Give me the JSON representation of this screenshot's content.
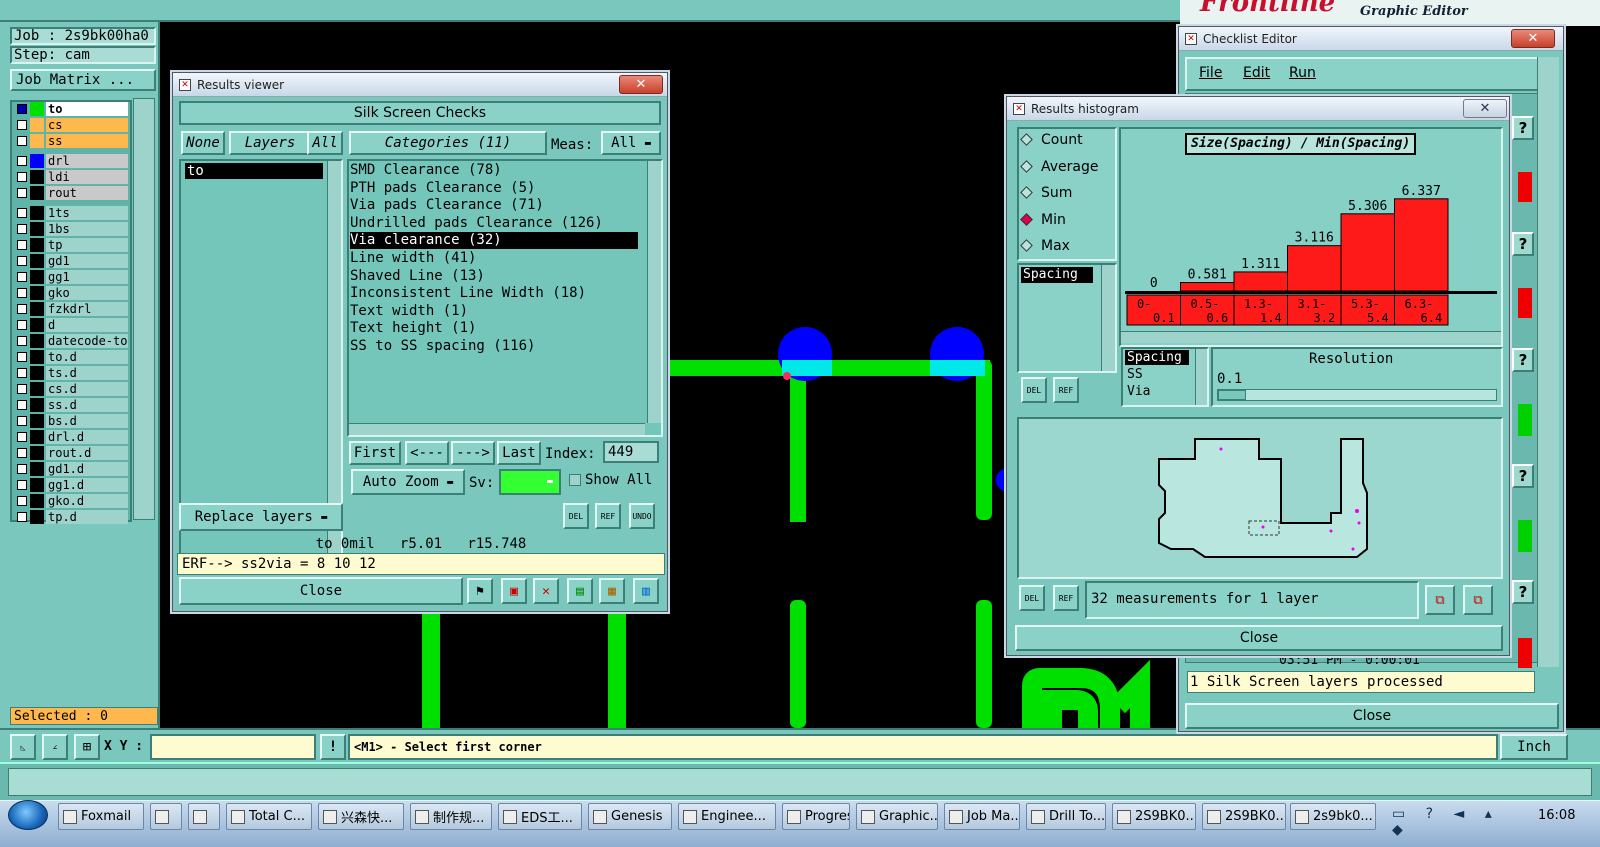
{
  "app": {
    "logo_text": "Frontline",
    "graphic_editor": "Graphic Editor"
  },
  "left_panel": {
    "job_label": "Job : 2s9bk00ha0",
    "step_label": "Step: cam",
    "job_matrix_button": "Job Matrix ...",
    "layers": [
      "to",
      "cs",
      "ss",
      "drl",
      "ldi",
      "rout",
      "1ts",
      "1bs",
      "tp",
      "gd1",
      "gg1",
      "gko",
      "fzkdrl",
      "d",
      "datecode-to",
      "to.d",
      "ts.d",
      "cs.d",
      "ss.d",
      "bs.d",
      "drl.d",
      "rout.d",
      "gd1.d",
      "gg1.d",
      "gko.d",
      "tp.d"
    ],
    "selected_label": "Selected : 0"
  },
  "results_viewer": {
    "title": "Results viewer",
    "header": "Silk Screen Checks",
    "none_btn": "None",
    "layers_btn": "Layers",
    "all_btn": "All",
    "layer_item": "to",
    "categories_btn": "Categories (11)",
    "meas_label": "Meas:",
    "meas_value": "All",
    "categories": [
      "SMD Clearance (78)",
      "PTH pads Clearance (5)",
      "Via pads Clearance (71)",
      "Undrilled pads Clearance (126)",
      "Via clearance (32)",
      "Line width (41)",
      "Shaved Line (13)",
      "Inconsistent Line Width (18)",
      "Text width (1)",
      "Text height (1)",
      "SS to SS spacing (116)"
    ],
    "selected_category": "Via clearance (32)",
    "first_btn": "First",
    "prev_btn": "<---",
    "next_btn": "--->",
    "last_btn": "Last",
    "index_label": "Index:",
    "index_value": "449",
    "auto_zoom": "Auto Zoom",
    "sv_label": "Sv:",
    "show_all": "Show All",
    "replace_layers": "Replace layers",
    "status_line": "to 0mil   r5.01   r15.748",
    "erf_line": "ERF--> ss2via = 8 10 12",
    "close_btn": "Close",
    "del_label": "DEL",
    "ref_label": "REF",
    "undo_label": "UNDO"
  },
  "histogram": {
    "title": "Results histogram",
    "radios": [
      "Count",
      "Average",
      "Sum",
      "Min",
      "Max"
    ],
    "selected_radio": "Min",
    "chart_title": "Size(Spacing) / Min(Spacing)",
    "list_items": [
      "Spacing"
    ],
    "list2": [
      "Spacing",
      "SS",
      "Via"
    ],
    "resolution_label": "Resolution",
    "resolution_value": "0.1",
    "measurements": "32 measurements for 1 layer",
    "close_btn": "Close",
    "del_label": "DEL",
    "ref_label": "REF"
  },
  "chart_data": {
    "type": "bar",
    "title": "Size(Spacing) / Min(Spacing)",
    "categories": [
      "0-\n0.1",
      "0.5-\n0.6",
      "1.3-\n1.4",
      "3.1-\n3.2",
      "5.3-\n5.4",
      "6.3-\n6.4"
    ],
    "values": [
      0,
      0.581,
      1.311,
      3.116,
      5.306,
      6.337
    ],
    "value_labels": [
      "0",
      "0.581",
      "1.311",
      "3.116",
      "5.306",
      "6.337"
    ],
    "ylim": [
      0,
      6.6
    ],
    "bar_color": "#ff1a1a"
  },
  "checklist": {
    "title": "Checklist Editor",
    "menu": [
      "File",
      "Edit",
      "Run"
    ],
    "time_text": "03:51 PM - 0:00:01",
    "processed": "1 Silk Screen layers processed",
    "close_btn": "Close"
  },
  "bottom": {
    "xy_label": "X Y :",
    "xy_value": "",
    "prompt": "<M1> - Select first corner",
    "unit": "Inch"
  },
  "taskbar": {
    "items": [
      "Foxmail",
      "",
      "",
      "Total C...",
      "兴森快...",
      "制作规...",
      "EDS工...",
      "Genesis",
      "Enginee...",
      "Progress",
      "Graphic...",
      "Job Ma...",
      "Drill To...",
      "2S9BK0...",
      "2S9BK0...",
      "2s9bk0..."
    ],
    "clock": "16:08"
  },
  "colors": {
    "panel": "#79c7bd",
    "pcb_green": "#00e000",
    "pad_blue": "#0000ff",
    "accent_orange": "#ffb84d",
    "bar_red": "#ff1a1a"
  }
}
